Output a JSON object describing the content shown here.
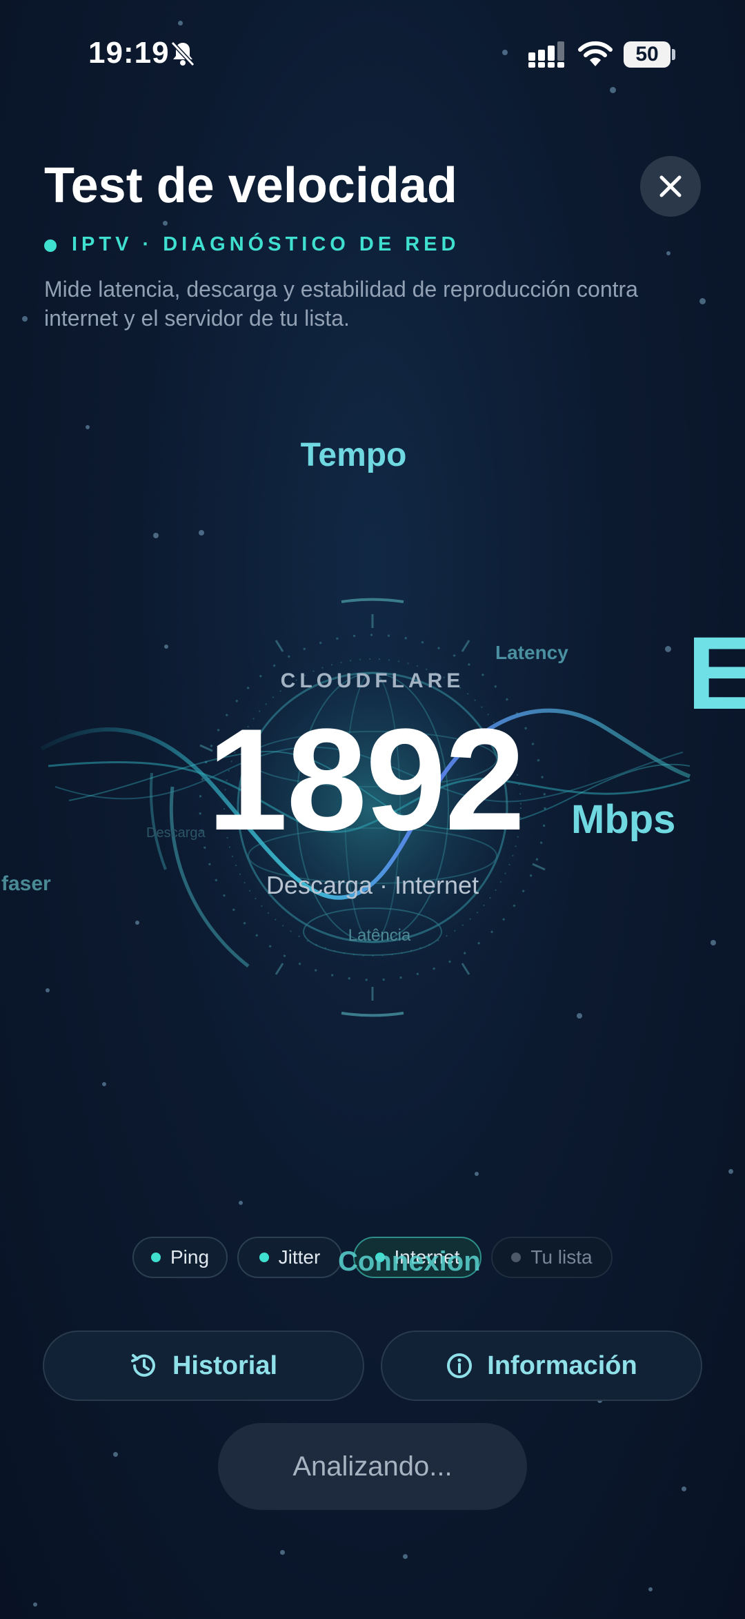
{
  "status_bar": {
    "time": "19:19",
    "battery": "50"
  },
  "header": {
    "title": "Test de velocidad",
    "tag": "IPTV · DIAGNÓSTICO DE RED",
    "description": "Mide latencia, descarga y estabilidad de reproducción contra internet y el servidor de tu lista."
  },
  "gauge": {
    "floating_label_top": "Tempo",
    "provider": "CLOUDFLARE",
    "value": "1892",
    "unit": "Mbps",
    "subtitle": "Descarga · Internet",
    "inner_label_latency": "Latência",
    "inner_label_download": "Descarga",
    "floating_latency": "Latency",
    "floating_left": "faser",
    "floating_right": "E"
  },
  "chips": [
    {
      "label": "Ping",
      "state": "done"
    },
    {
      "label": "Jitter",
      "state": "done"
    },
    {
      "label": "Internet",
      "state": "active"
    },
    {
      "label": "Tu lista",
      "state": "pending"
    }
  ],
  "floating_connexion": "Connexion",
  "buttons": {
    "history": "Historial",
    "info": "Información",
    "analyze": "Analizando..."
  },
  "colors": {
    "accent": "#3fe0cf",
    "background": "#0c1a30",
    "primary_text": "#ffffff"
  },
  "icons": [
    "bell-slash-icon",
    "signal-icon",
    "wifi-icon",
    "battery-icon",
    "close-icon",
    "history-icon",
    "info-icon"
  ]
}
